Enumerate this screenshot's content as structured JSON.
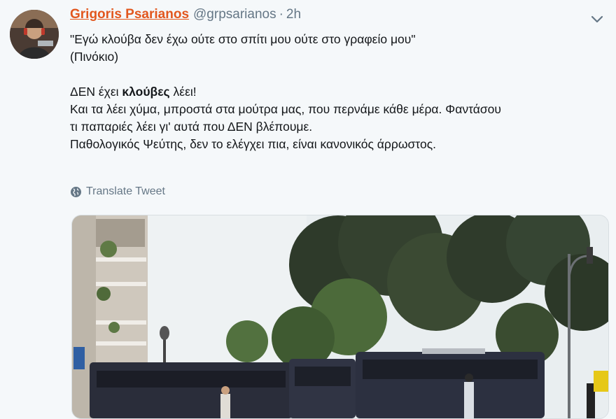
{
  "tweet": {
    "author_name": "Grigoris Psarianos",
    "handle": "@grpsarianos",
    "separator": "·",
    "time": "2h",
    "lines": [
      "\"Εγώ κλούβα δεν έχω ούτε στο σπίτι μου ούτε στο γραφείο μου\"",
      "(Πινόκιο)"
    ],
    "line3_pre": "ΔΕΝ έχει ",
    "line3_bold": "κλούβες",
    "line3_post": " λέει!",
    "lines2": [
      "Και τα λέει χύμα, μπροστά στα μούτρα μας, που περνάμε κάθε μέρα. Φαντάσου",
      "τι παπαριές λέει γι' αυτά που ΔΕΝ βλέπουμε.",
      "Παθολογικός Ψεύτης, δεν το ελέγχει πια, είναι κανονικός  άρρωστος."
    ],
    "translate_label": "Translate Tweet",
    "icons": {
      "avatar": "avatar-photo",
      "caret": "chevron-down-icon",
      "translate": "globe-icon"
    },
    "colors": {
      "name": "#e2571e",
      "muted": "#657786",
      "background": "#f5f8fa"
    }
  }
}
